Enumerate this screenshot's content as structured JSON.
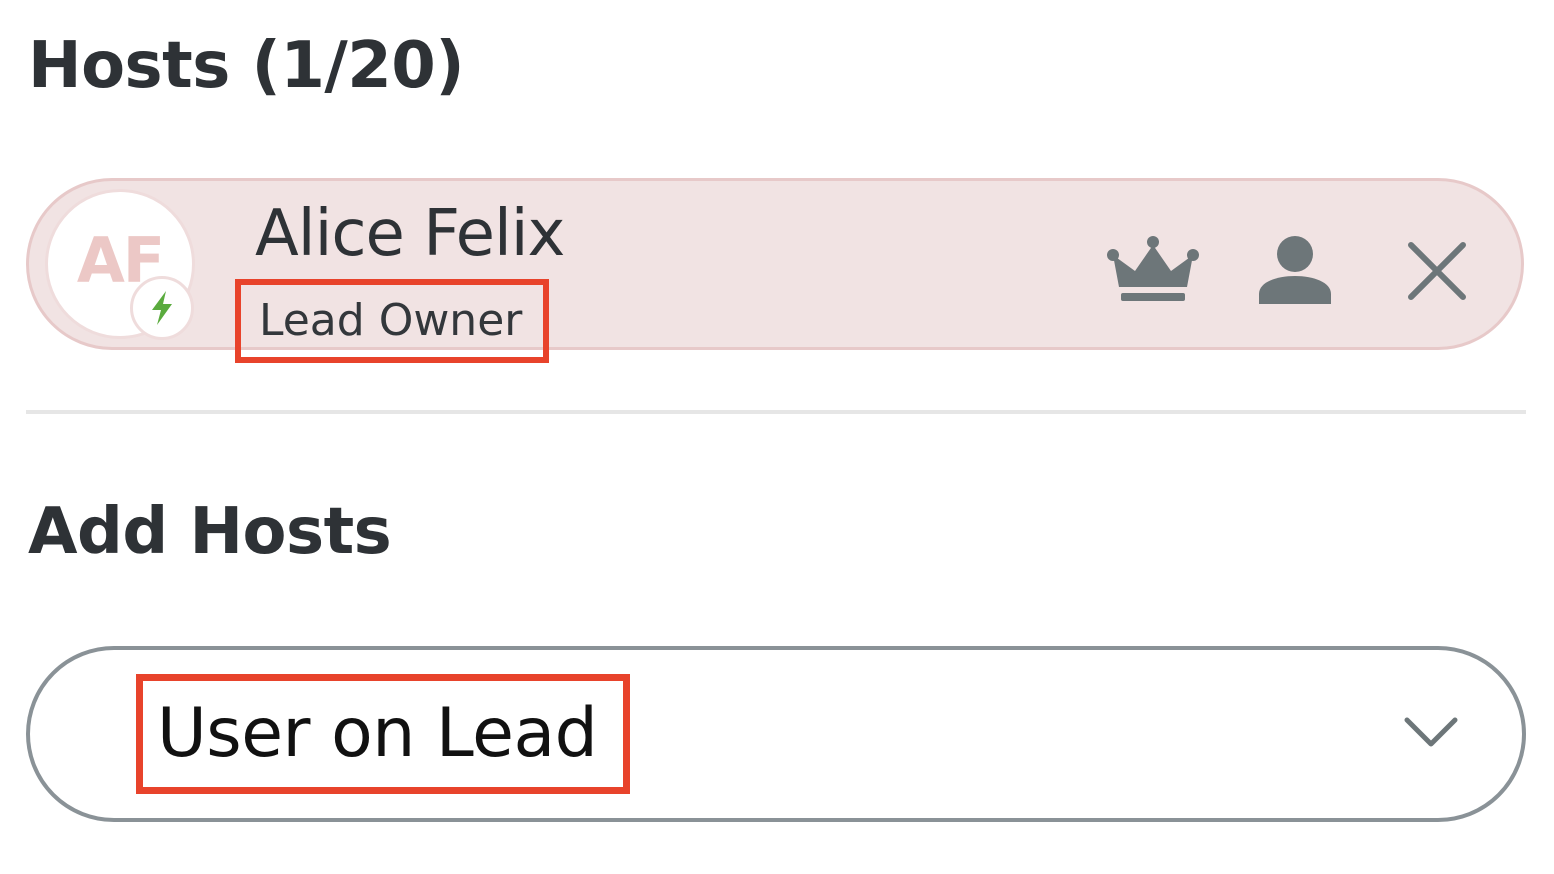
{
  "hosts_section": {
    "title": "Hosts (1/20)"
  },
  "host": {
    "initials": "AF",
    "name": "Alice Felix",
    "role": "Lead Owner",
    "badge_icon": "lightning-bolt-icon",
    "actions": [
      {
        "icon": "crown-icon",
        "name": "make-lead-host"
      },
      {
        "icon": "person-icon",
        "name": "host-user"
      },
      {
        "icon": "close-icon",
        "name": "remove-host"
      }
    ]
  },
  "add_hosts_section": {
    "title": "Add Hosts",
    "select": {
      "value": "User on Lead",
      "icon": "chevron-down-icon"
    }
  },
  "colors": {
    "card_background": "#f1e3e3",
    "card_border": "#e7c9c9",
    "highlight": "#e8432b",
    "bolt_green": "#5aab3e",
    "icon_gray": "#6d7679"
  }
}
